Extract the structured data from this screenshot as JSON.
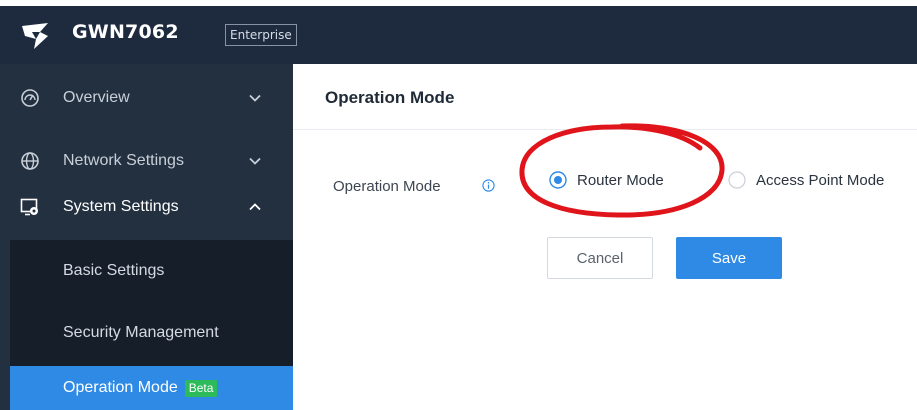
{
  "app": {
    "product": "GWN7062",
    "edition": "Enterprise"
  },
  "sidebar": {
    "items": [
      {
        "label": "Overview",
        "icon": "dashboard-icon",
        "state": "collapsed"
      },
      {
        "label": "Network Settings",
        "icon": "globe-icon",
        "state": "collapsed"
      },
      {
        "label": "System Settings",
        "icon": "system-settings-icon",
        "state": "expanded"
      }
    ],
    "submenu": [
      {
        "label": "Basic Settings"
      },
      {
        "label": "Security Management"
      },
      {
        "label": "Operation Mode",
        "badge": "Beta",
        "selected": true
      }
    ]
  },
  "main": {
    "title": "Operation Mode",
    "field": {
      "label": "Operation Mode",
      "options": [
        {
          "label": "Router Mode",
          "checked": true
        },
        {
          "label": "Access Point Mode",
          "checked": false
        }
      ]
    },
    "buttons": {
      "cancel": "Cancel",
      "save": "Save"
    }
  },
  "colors": {
    "topbar": "#1e2b3f",
    "sidebar": "#23303f",
    "submenu": "#151e29",
    "accent": "#2f8ae6",
    "beta": "#2dba5a",
    "annotation": "#e0151b"
  }
}
